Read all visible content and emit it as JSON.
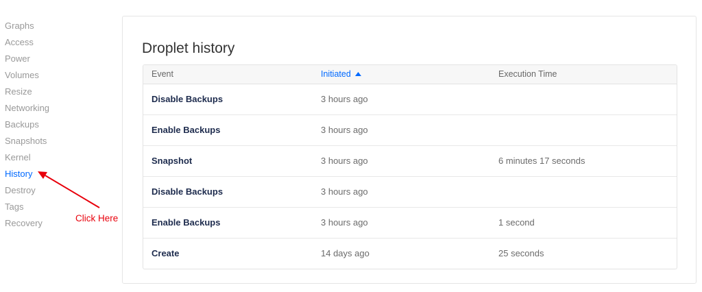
{
  "sidebar": {
    "items": [
      {
        "label": "Graphs"
      },
      {
        "label": "Access"
      },
      {
        "label": "Power"
      },
      {
        "label": "Volumes"
      },
      {
        "label": "Resize"
      },
      {
        "label": "Networking"
      },
      {
        "label": "Backups"
      },
      {
        "label": "Snapshots"
      },
      {
        "label": "Kernel"
      },
      {
        "label": "History"
      },
      {
        "label": "Destroy"
      },
      {
        "label": "Tags"
      },
      {
        "label": "Recovery"
      }
    ],
    "active": "History"
  },
  "annotation": {
    "text": "Click Here",
    "color": "#e8000b"
  },
  "panel": {
    "title": "Droplet history"
  },
  "table": {
    "columns": [
      "Event",
      "Initiated",
      "Execution Time"
    ],
    "sorted_column": "Initiated",
    "sort_direction": "ascending",
    "rows": [
      {
        "event": "Disable Backups",
        "initiated": "3 hours ago",
        "execution_time": ""
      },
      {
        "event": "Enable Backups",
        "initiated": "3 hours ago",
        "execution_time": ""
      },
      {
        "event": "Snapshot",
        "initiated": "3 hours ago",
        "execution_time": "6 minutes 17 seconds"
      },
      {
        "event": "Disable Backups",
        "initiated": "3 hours ago",
        "execution_time": ""
      },
      {
        "event": "Enable Backups",
        "initiated": "3 hours ago",
        "execution_time": "1 second"
      },
      {
        "event": "Create",
        "initiated": "14 days ago",
        "execution_time": "25 seconds"
      }
    ]
  },
  "colors": {
    "accent": "#0069ff",
    "muted_text": "#999999",
    "event_text": "#1d2b4d"
  },
  "icons": {
    "sort": "caret-up-icon",
    "annotation": "arrow-icon"
  }
}
